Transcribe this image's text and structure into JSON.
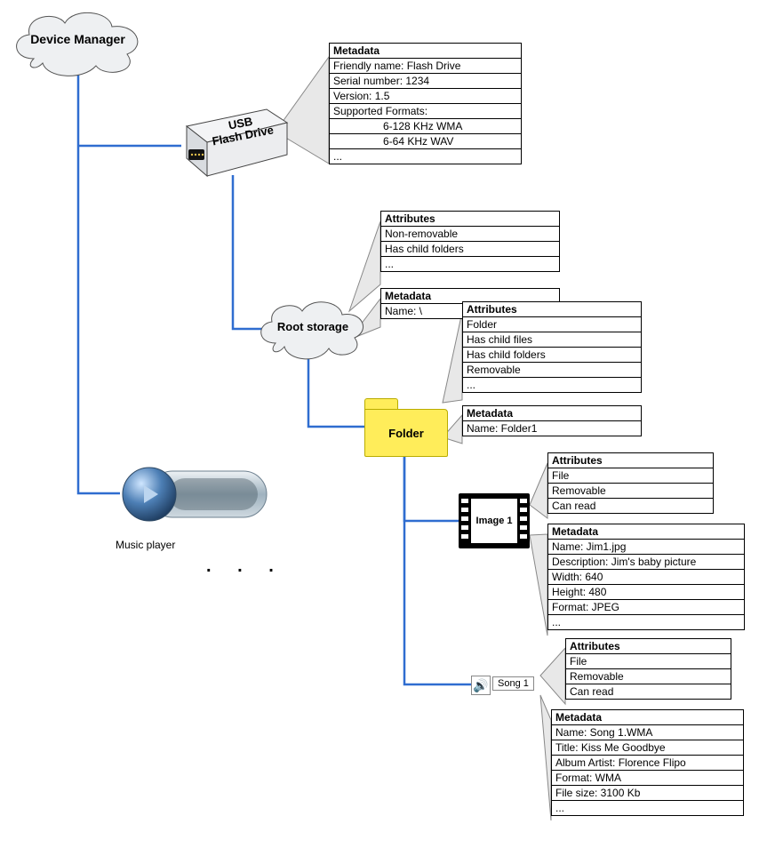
{
  "nodes": {
    "device_manager": "Device Manager",
    "usb_line1": "USB",
    "usb_line2": "Flash Drive",
    "root_storage": "Root storage",
    "folder": "Folder",
    "image1": "Image 1",
    "song1": "Song 1",
    "music_player": "Music player",
    "ellipsis": ".  .  ."
  },
  "usb_panel": {
    "header": "Metadata",
    "rows": [
      {
        "k": "Friendly name:",
        "v": " Flash Drive"
      },
      {
        "k": "Serial number:",
        "v": " 1234"
      },
      {
        "k": "Version:",
        "v": " 1.5"
      },
      {
        "k": "Supported Formats:",
        "v": ""
      },
      {
        "indent": true,
        "v": "6-128 KHz WMA"
      },
      {
        "indent": true,
        "v": "6-64 KHz WAV"
      },
      {
        "v": "..."
      }
    ]
  },
  "root_attr_panel": {
    "header": "Attributes",
    "rows": [
      {
        "v": "Non-removable"
      },
      {
        "v": "Has child folders"
      },
      {
        "v": "..."
      }
    ]
  },
  "root_meta_panel": {
    "header": "Metadata",
    "rows": [
      {
        "k": "Name:",
        "v": " \\"
      }
    ]
  },
  "folder_attr_panel": {
    "header": "Attributes",
    "rows": [
      {
        "v": "Folder"
      },
      {
        "v": "Has child files"
      },
      {
        "v": "Has child folders"
      },
      {
        "v": "Removable"
      },
      {
        "v": "..."
      }
    ]
  },
  "folder_meta_panel": {
    "header": "Metadata",
    "rows": [
      {
        "k": "Name:",
        "v": " Folder1"
      }
    ]
  },
  "image_attr_panel": {
    "header": "Attributes",
    "rows": [
      {
        "v": "File"
      },
      {
        "v": "Removable"
      },
      {
        "v": "Can read"
      }
    ]
  },
  "image_meta_panel": {
    "header": "Metadata",
    "rows": [
      {
        "k": "Name:",
        "v": " Jim1.jpg"
      },
      {
        "k": "Description:",
        "v": " Jim's baby picture"
      },
      {
        "k": "Width:",
        "v": " 640"
      },
      {
        "k": "Height:",
        "v": " 480"
      },
      {
        "k": "Format:",
        "v": " JPEG"
      },
      {
        "v": "..."
      }
    ]
  },
  "song_attr_panel": {
    "header": "Attributes",
    "rows": [
      {
        "v": "File"
      },
      {
        "v": "Removable"
      },
      {
        "v": "Can read"
      }
    ]
  },
  "song_meta_panel": {
    "header": "Metadata",
    "rows": [
      {
        "k": "Name:",
        "v": " Song 1.WMA"
      },
      {
        "k": "Title:",
        "v": " Kiss Me Goodbye"
      },
      {
        "k": "Album Artist:",
        "v": " Florence Flipo"
      },
      {
        "k": "Format:",
        "v": " WMA"
      },
      {
        "k": "File size:",
        "v": " 3100 Kb"
      },
      {
        "v": "..."
      }
    ]
  }
}
